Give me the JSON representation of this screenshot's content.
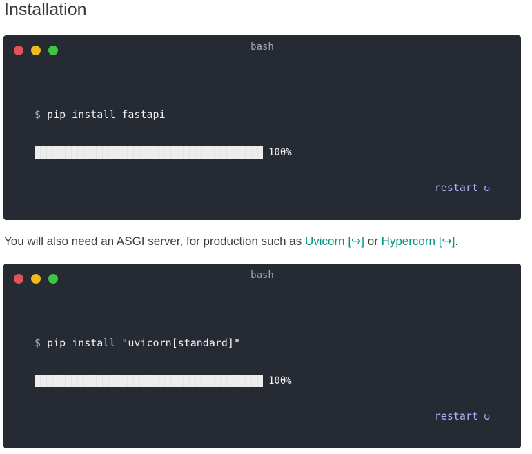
{
  "heading": "Installation",
  "terminal1": {
    "title": "bash",
    "prompt": "$",
    "command": "pip install fastapi",
    "progress": 1.0,
    "progress_label": "100%",
    "restart_label": "restart",
    "restart_icon": "↻"
  },
  "paragraph": {
    "text_before": "You will also need an ASGI server, for production such as ",
    "link1": "Uvicorn",
    "link1_marker": " [↪]",
    "text_middle": " or ",
    "link2": "Hypercorn",
    "link2_marker": " [↪]",
    "text_after": "."
  },
  "terminal2": {
    "title": "bash",
    "prompt": "$",
    "command": "pip install \"uvicorn[standard]\"",
    "progress": 1.0,
    "progress_label": "100%",
    "restart_label": "restart",
    "restart_icon": "↻"
  },
  "colors": {
    "terminal_bg": "#252a33",
    "link": "#009485",
    "restart": "#aeb5ff",
    "dot_red": "#e0535c",
    "dot_yellow": "#f0b91d",
    "dot_green": "#3cc541"
  }
}
